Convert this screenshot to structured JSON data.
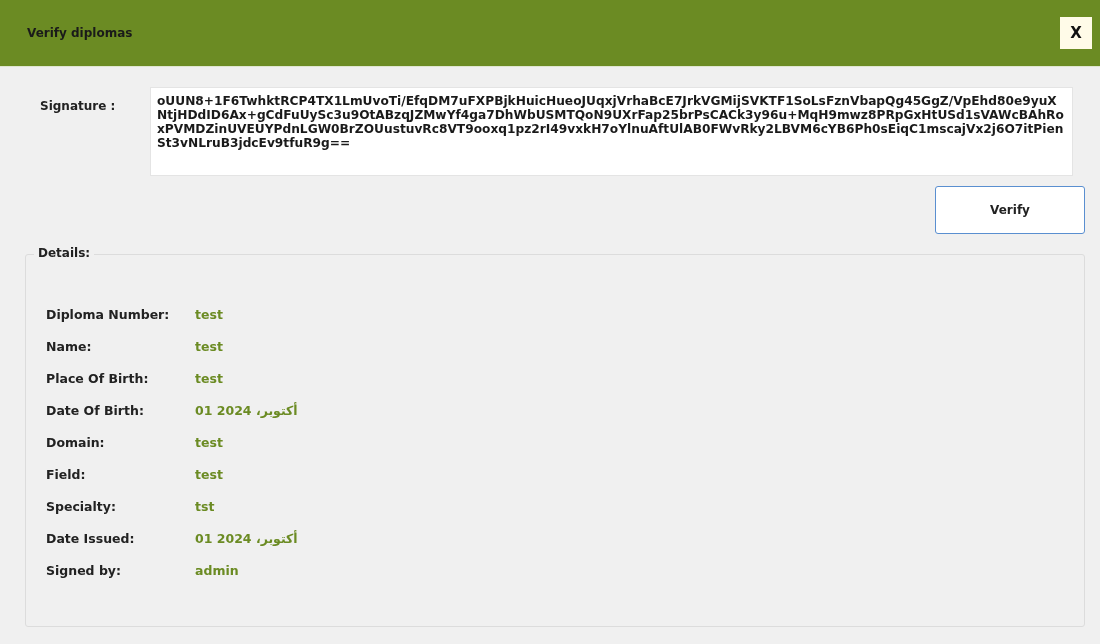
{
  "window": {
    "title": "Verify diplomas",
    "close_label": "X"
  },
  "signature": {
    "label": "Signature :",
    "value": "oUUN8+1F6TwhktRCP4TX1LmUvoTi/EfqDM7uFXPBjkHuicHueoJUqxjVrhaBcE7JrkVGMijSVKTF1SoLsFznVbapQg45GgZ/VpEhd80e9yuXNtjHDdID6Ax+gCdFuUySc3u9OtABzqJZMwYf4ga7DhWbUSMTQoN9UXrFap25brPsCACk3y96u+MqH9mwz8PRpGxHtUSd1sVAWcBAhRoxPVMDZinUVEUYPdnLGW0BrZOUustuvRc8VT9ooxq1pz2rI49vxkH7oYlnuAftUlAB0FWvRky2LBVM6cYB6Ph0sEiqC1mscajVx2j6O7itPienSt3vNLruB3jdcEv9tfuR9g=="
  },
  "verify_button": "Verify",
  "details": {
    "title": "Details:",
    "rows": [
      {
        "label": "Diploma Number:",
        "value": "test"
      },
      {
        "label": "Name:",
        "value": "test"
      },
      {
        "label": "Place Of Birth:",
        "value": "test"
      },
      {
        "label": "Date Of Birth:",
        "value": "01 2024 ،أكتوبر"
      },
      {
        "label": "Domain:",
        "value": "test"
      },
      {
        "label": "Field:",
        "value": "test"
      },
      {
        "label": "Specialty:",
        "value": "tst"
      },
      {
        "label": "Date Issued:",
        "value": "01 2024 ،أكتوبر"
      },
      {
        "label": "Signed by:",
        "value": "admin"
      }
    ]
  }
}
